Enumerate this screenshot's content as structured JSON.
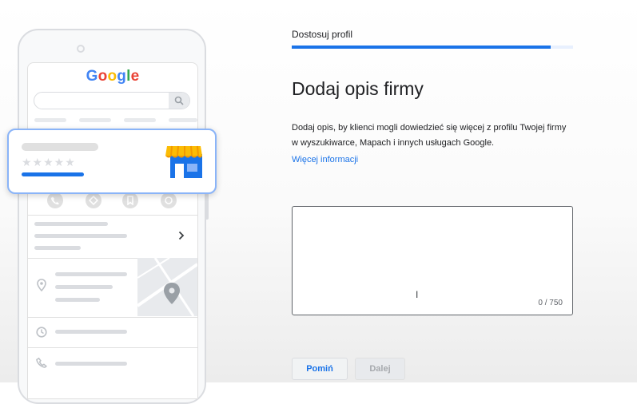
{
  "phone": {
    "logo": [
      "G",
      "o",
      "o",
      "g",
      "l",
      "e"
    ],
    "card_rating_stars": 5
  },
  "wizard": {
    "step_title": "Dostosuj profil",
    "progress": 0.92,
    "heading": "Dodaj opis firmy",
    "description": "Dodaj opis, by klienci mogli dowiedzieć się więcej z profilu Twojej firmy w wyszukiwarce, Mapach i innych usługach Google.",
    "learn_more": "Więcej informacji",
    "description_input": {
      "value": "",
      "counter": "0 / 750"
    },
    "buttons": {
      "skip": "Pomiń",
      "next": "Dalej"
    }
  },
  "colors": {
    "accent": "#1a73e8",
    "card_border": "#8ab4f8",
    "store_awning": "#fbbc05",
    "store_body": "#1a73e8"
  },
  "icons": [
    "search-icon",
    "phone-icon",
    "directions-icon",
    "bookmark-icon",
    "share-icon",
    "chevron-right-icon",
    "location-pin-icon",
    "clock-icon",
    "store-icon",
    "text-cursor-icon"
  ]
}
